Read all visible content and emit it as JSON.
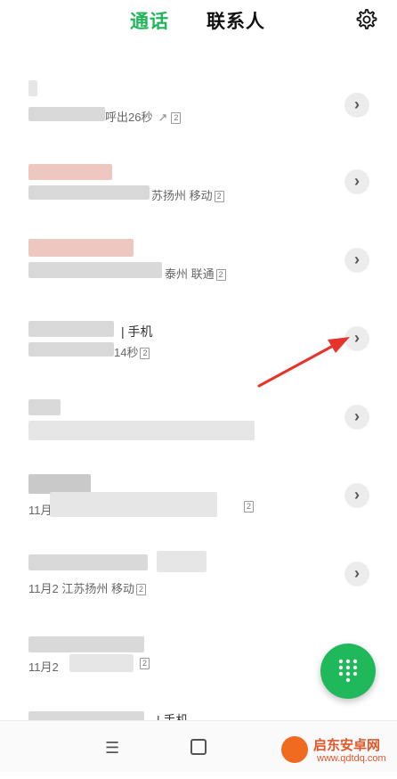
{
  "header": {
    "tabs": [
      {
        "label": "通话",
        "active": true
      },
      {
        "label": "联系人",
        "active": false
      }
    ],
    "settings_icon": "gear-icon"
  },
  "calls": [
    {
      "sub_text": "呼出26秒",
      "direction": "outgoing",
      "sim": "2"
    },
    {
      "sub_text": "苏扬州 移动",
      "sim": "2"
    },
    {
      "sub_text": "泰州 联通",
      "sim": "2"
    },
    {
      "name_tail": "| 手机",
      "sub_text": "14秒",
      "sim": "2"
    },
    {
      "sub_text": ""
    },
    {
      "sub_text": "11月",
      "sim": "2"
    },
    {
      "sub_text": "11月2 江苏扬州 移动",
      "sim": "2"
    },
    {
      "sub_text": "11月2",
      "sim": "2"
    },
    {
      "name_tail": "| 手机"
    }
  ],
  "fab": {
    "icon": "dialpad-icon"
  },
  "nav": {
    "menu_glyph": "☰"
  },
  "watermark": {
    "title": "启东安卓网",
    "url": "www.qdtdq.com"
  },
  "colors": {
    "accent": "#1fb65a",
    "annotation_arrow": "#e8332a"
  }
}
